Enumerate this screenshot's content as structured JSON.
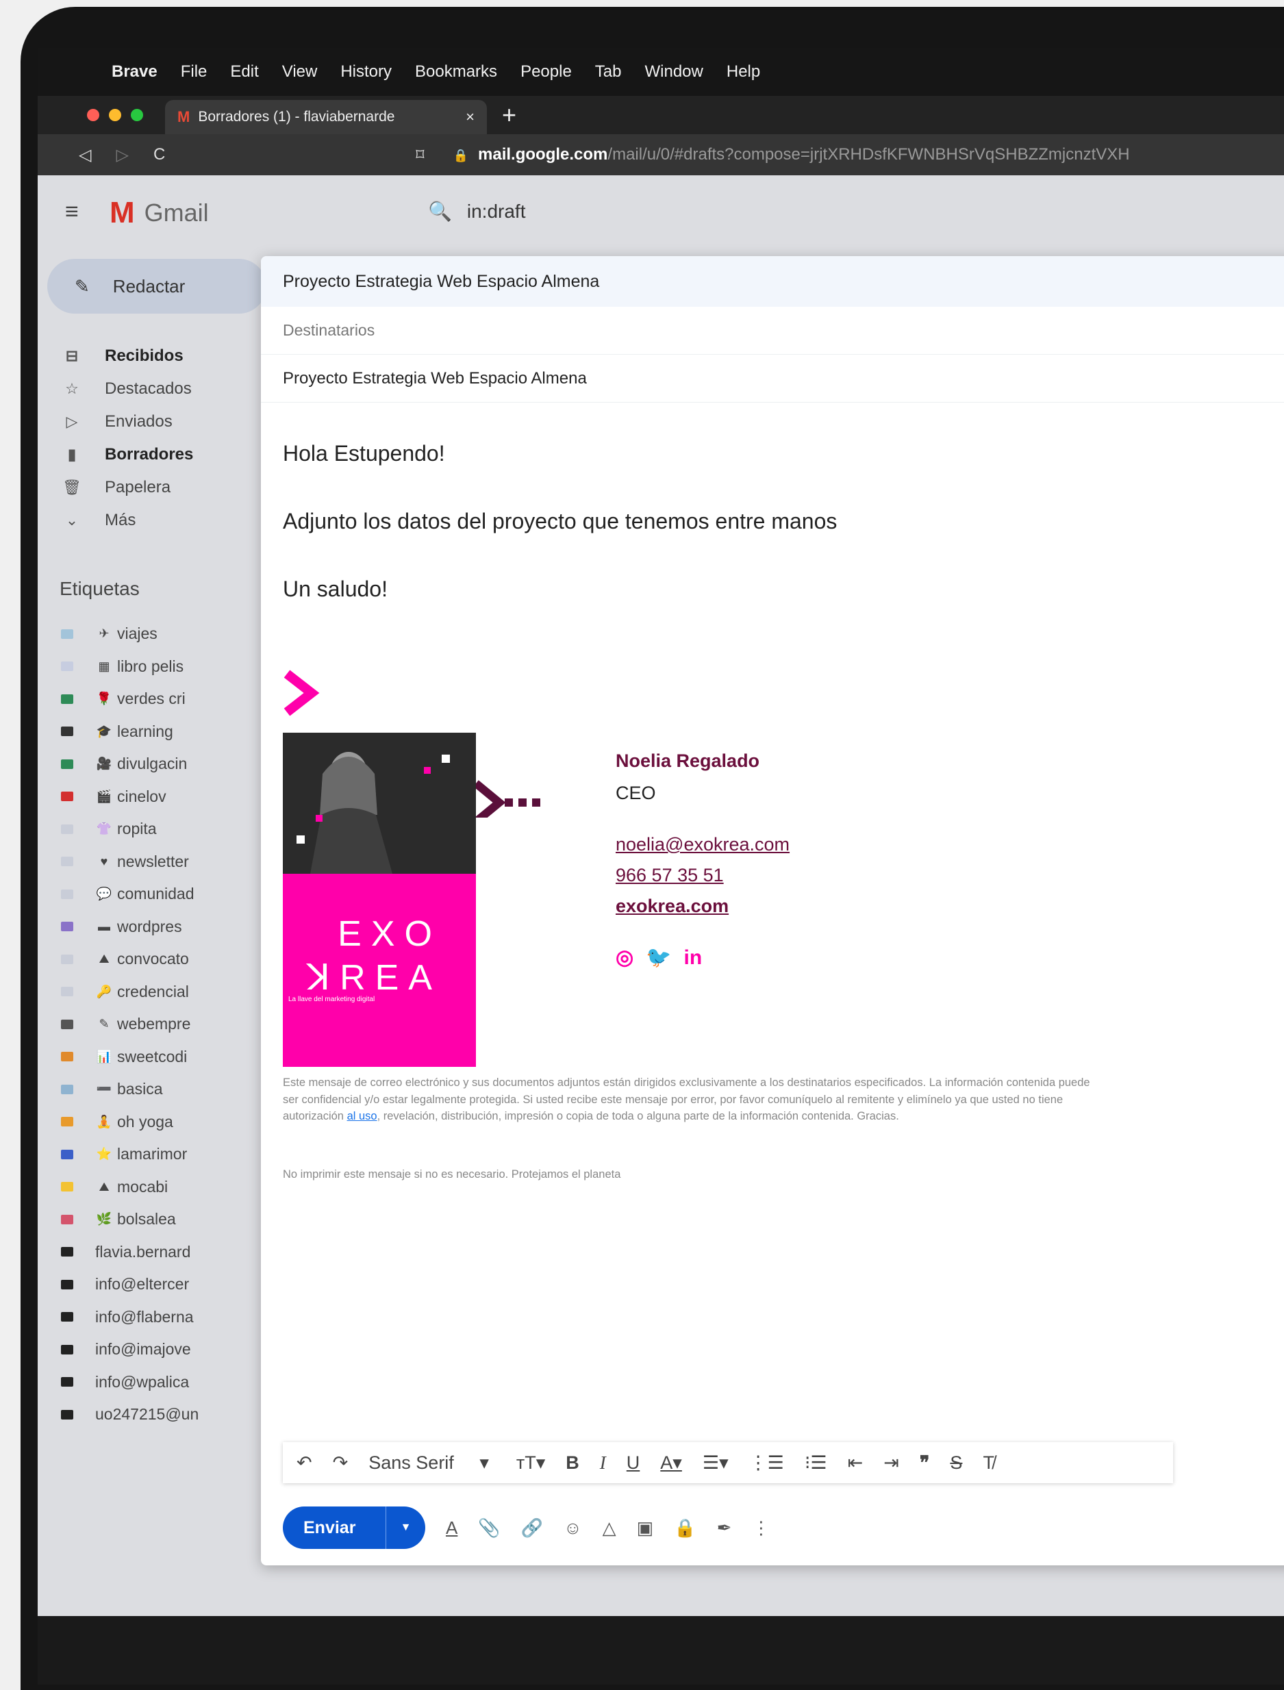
{
  "menubar": {
    "app": "Brave",
    "items": [
      "File",
      "Edit",
      "View",
      "History",
      "Bookmarks",
      "People",
      "Tab",
      "Window",
      "Help"
    ]
  },
  "tab": {
    "title": "Borradores (1) - flaviabernarde"
  },
  "address": {
    "host": "mail.google.com",
    "path": "/mail/u/0/#drafts?compose=jrjtXRHDsfKFWNBHSrVqSHBZZmjcnztVXH"
  },
  "gmail": {
    "wordmark": "Gmail",
    "search": "in:draft"
  },
  "sidebar": {
    "compose": "Redactar",
    "items": [
      {
        "label": "Recibidos",
        "icon": "inbox-icon",
        "glyph": "⊟",
        "bold": true
      },
      {
        "label": "Destacados",
        "icon": "star-icon",
        "glyph": "☆",
        "bold": false
      },
      {
        "label": "Enviados",
        "icon": "send-icon",
        "glyph": "▷",
        "bold": false
      },
      {
        "label": "Borradores",
        "icon": "draft-icon",
        "glyph": "▮",
        "bold": true
      },
      {
        "label": "Papelera",
        "icon": "trash-icon",
        "glyph": "🗑",
        "bold": false
      },
      {
        "label": "Más",
        "icon": "chevron-down-icon",
        "glyph": "⌄",
        "bold": false
      }
    ],
    "labels_title": "Etiquetas",
    "labels": [
      {
        "label": "viajes",
        "color": "#a3c4da",
        "emoji": "✈"
      },
      {
        "label": "libro pelis",
        "color": "#c7cde0",
        "emoji": "▦"
      },
      {
        "label": "verdes cri",
        "color": "#2e8b57",
        "emoji": "🌹"
      },
      {
        "label": "learning",
        "color": "#333333",
        "emoji": "🎓"
      },
      {
        "label": "divulgacin",
        "color": "#2e8b57",
        "emoji": "🎥"
      },
      {
        "label": "cinelov",
        "color": "#d32f2f",
        "emoji": "🎬"
      },
      {
        "label": "ropita",
        "color": "#c9cdd8",
        "emoji": "👚"
      },
      {
        "label": "newsletter",
        "color": "#c9cdd8",
        "emoji": "♥"
      },
      {
        "label": "comunidad",
        "color": "#c9cdd8",
        "emoji": "💬"
      },
      {
        "label": "wordpres",
        "color": "#8a72c8",
        "emoji": "▬"
      },
      {
        "label": "convocato",
        "color": "#c9cdd8",
        "emoji": "⛰"
      },
      {
        "label": "credencial",
        "color": "#c9cdd8",
        "emoji": "🔑"
      },
      {
        "label": "webempre",
        "color": "#555555",
        "emoji": "✎"
      },
      {
        "label": "sweetcodi",
        "color": "#e08a2c",
        "emoji": "📊"
      },
      {
        "label": "basica",
        "color": "#8fb3d0",
        "emoji": "➖"
      },
      {
        "label": "oh yoga",
        "color": "#e89a2c",
        "emoji": "🧘"
      },
      {
        "label": "lamarimor",
        "color": "#3b5fc8",
        "emoji": "⭐"
      },
      {
        "label": "mocabi",
        "color": "#f3c232",
        "emoji": "⛰"
      },
      {
        "label": "bolsalea",
        "color": "#d4546c",
        "emoji": "🌿"
      },
      {
        "label": "flavia.bernard",
        "color": "#222222",
        "emoji": ""
      },
      {
        "label": "info@eltercer",
        "color": "#222222",
        "emoji": ""
      },
      {
        "label": "info@flaberna",
        "color": "#222222",
        "emoji": ""
      },
      {
        "label": "info@imajove",
        "color": "#222222",
        "emoji": ""
      },
      {
        "label": "info@wpalica",
        "color": "#222222",
        "emoji": ""
      },
      {
        "label": "uo247215@un",
        "color": "#222222",
        "emoji": ""
      }
    ]
  },
  "compose": {
    "title": "Proyecto Estrategia Web Espacio Almena",
    "recipients_placeholder": "Destinatarios",
    "subject": "Proyecto Estrategia Web Espacio Almena",
    "body": [
      "Hola Estupendo!",
      "Adjunto los datos del proyecto que tenemos entre manos",
      "Un saludo!"
    ],
    "signature": {
      "name": "Noelia Regalado",
      "role": "CEO",
      "email": "noelia@exokrea.com",
      "phone": "966 57 35 51",
      "web": "exokrea.com",
      "logo_line1": "EXO",
      "logo_line2": "ꓘREA",
      "tagline": "La llave del marketing digital",
      "brand_color": "#ff00aa"
    },
    "legal_pre": "Este mensaje de correo electrónico y sus documentos adjuntos están dirigidos exclusivamente a los destinatarios especificados. La información contenida puede ser confidencial y/o estar legalmente protegida. Si usted recibe este mensaje por error, por favor comuníquelo al remitente y elimínelo ya que usted no tiene autorización ",
    "legal_link": "al uso",
    "legal_post": ", revelación, distribución, impresión o copia de toda o alguna parte de la información contenida. Gracias.",
    "no_print": "No imprimir este mensaje si no es necesario. Protejamos el planeta",
    "font": "Sans Serif",
    "send_label": "Enviar"
  }
}
